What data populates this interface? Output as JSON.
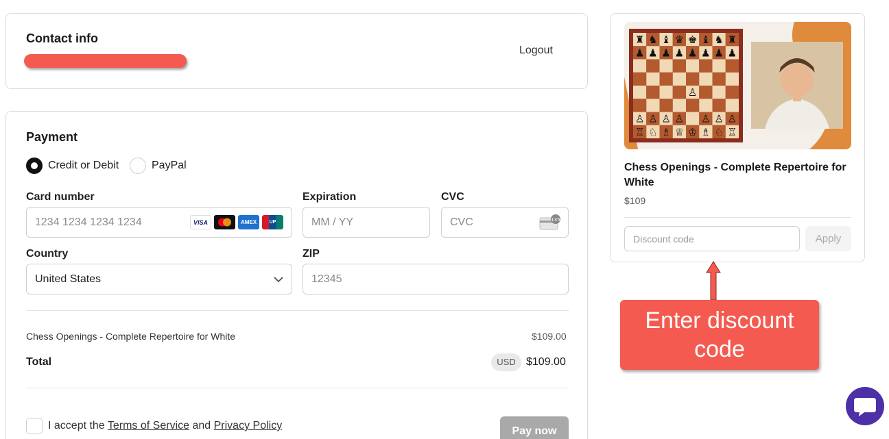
{
  "contact": {
    "title": "Contact info",
    "logout": "Logout"
  },
  "payment": {
    "title": "Payment",
    "methods": [
      {
        "label": "Credit or Debit",
        "selected": true
      },
      {
        "label": "PayPal",
        "selected": false
      }
    ],
    "card_number": {
      "label": "Card number",
      "placeholder": "1234 1234 1234 1234",
      "brands": [
        "visa-icon",
        "mastercard-icon",
        "amex-icon",
        "unionpay-icon"
      ]
    },
    "expiration": {
      "label": "Expiration",
      "placeholder": "MM / YY"
    },
    "cvc": {
      "label": "CVC",
      "placeholder": "CVC",
      "icon": "cvc-card-icon",
      "badge": "135"
    },
    "country": {
      "label": "Country",
      "value": "United States"
    },
    "zip": {
      "label": "ZIP",
      "placeholder": "12345"
    },
    "summary": {
      "item_name": "Chess Openings - Complete Repertoire for White",
      "item_price": "$109.00",
      "total_label": "Total",
      "currency": "USD",
      "total_value": "$109.00"
    },
    "terms": {
      "prefix": "I accept the",
      "tos": "Terms of Service",
      "and": "and",
      "privacy": "Privacy Policy"
    },
    "pay_button": "Pay now"
  },
  "product": {
    "title": "Chess Openings - Complete Repertoire for White",
    "price": "$109",
    "discount_placeholder": "Discount code",
    "apply_label": "Apply"
  },
  "callout": {
    "line1": "Enter discount",
    "line2": "code"
  },
  "colors": {
    "accent_red": "#f45a4f",
    "chat_purple": "#4d2fa8",
    "board_dark": "#b35a2e",
    "board_light": "#f1d9b5"
  }
}
